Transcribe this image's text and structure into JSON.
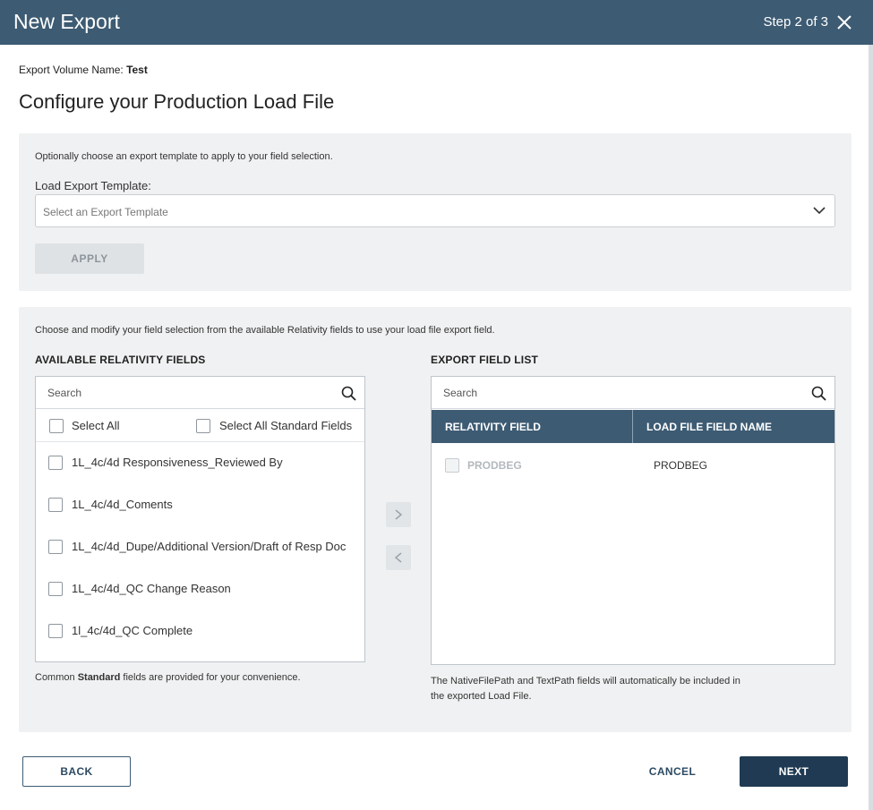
{
  "header": {
    "title": "New Export",
    "step": "Step 2 of 3"
  },
  "export_volume": {
    "label": "Export Volume Name:",
    "value": "Test"
  },
  "page_title": "Configure your Production Load File",
  "template_section": {
    "description": "Optionally choose an export template to apply to your field selection.",
    "label": "Load Export Template:",
    "placeholder": "Select an Export Template",
    "apply_label": "APPLY"
  },
  "fields_section": {
    "description": "Choose and modify your field selection from the available Relativity fields to use your load file export field.",
    "available": {
      "heading": "AVAILABLE RELATIVITY FIELDS",
      "search_placeholder": "Search",
      "select_all": "Select All",
      "select_all_standard": "Select All Standard Fields",
      "items": [
        "1L_4c/4d Responsiveness_Reviewed By",
        "1L_4c/4d_Coments",
        "1L_4c/4d_Dupe/Additional Version/Draft of Resp Doc",
        "1L_4c/4d_QC Change Reason",
        "1l_4c/4d_QC Complete"
      ],
      "footnote_pre": "Common ",
      "footnote_bold": "Standard",
      "footnote_post": " fields are provided for your convenience."
    },
    "export": {
      "heading": "EXPORT FIELD LIST",
      "search_placeholder": "Search",
      "col_relativity": "RELATIVITY FIELD",
      "col_loadfile": "LOAD FILE FIELD NAME",
      "rows": [
        {
          "relativity_field": "PRODBEG",
          "load_file_name": "PRODBEG"
        }
      ],
      "note_line1": "The NativeFilePath and TextPath fields will automatically be included in",
      "note_line2": "the exported Load File."
    }
  },
  "footer": {
    "back": "BACK",
    "cancel": "CANCEL",
    "next": "NEXT"
  },
  "colors": {
    "header": "#3d5b73",
    "primary_button": "#1f3a52",
    "panel_bg": "#f0f1f2"
  }
}
